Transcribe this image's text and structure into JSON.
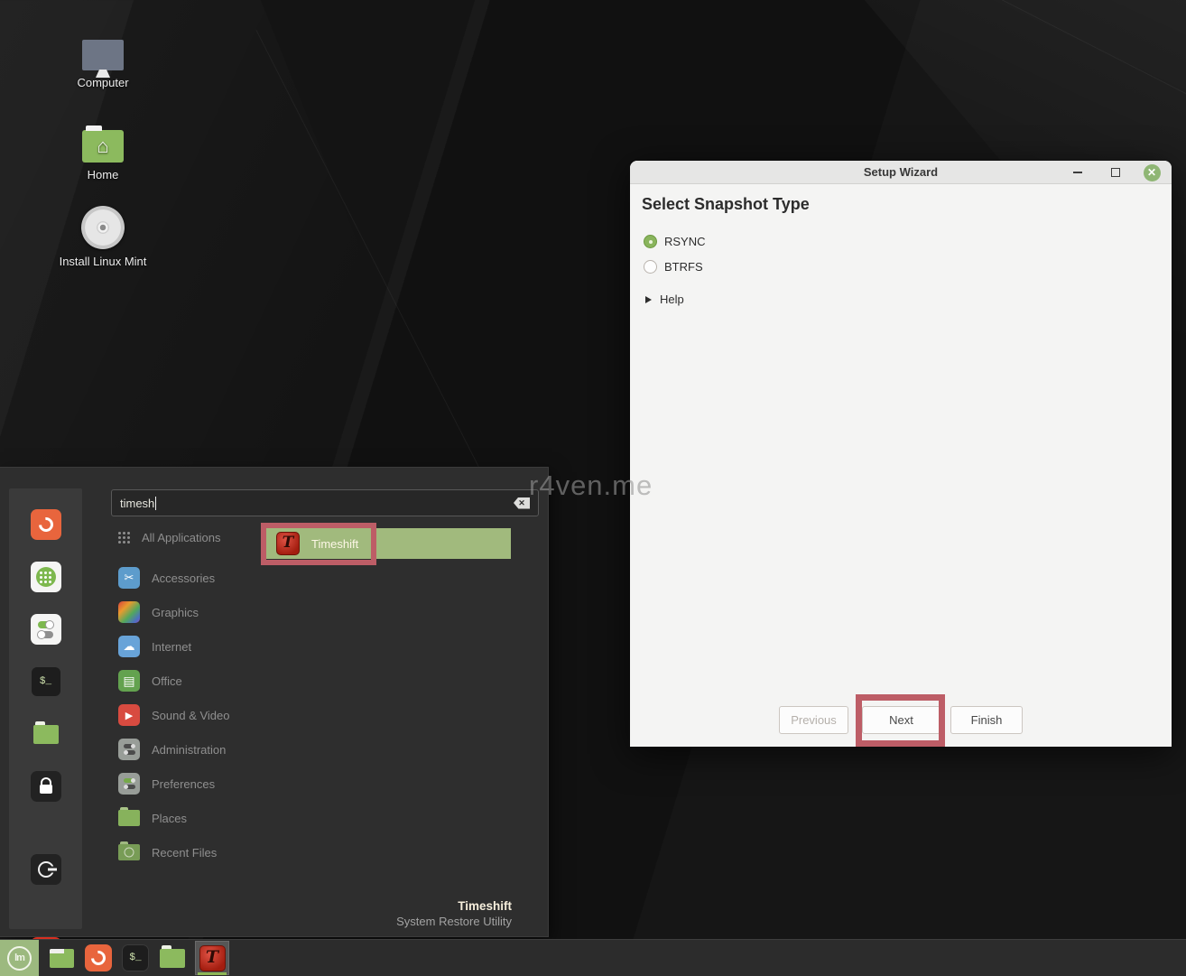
{
  "colors": {
    "selection_green": "#a1ba7d",
    "annotation_red": "#bd5d66",
    "timeshift_red": "#b3220f",
    "close_button_green": "#8fb674",
    "mint_button_green": "#9cb97f",
    "window_body": "#f4f4f3",
    "menu_background": "#2e2e2e"
  },
  "desktop": {
    "watermark": "r4ven.me",
    "icons": [
      {
        "name": "computer",
        "label": "Computer"
      },
      {
        "name": "home",
        "label": "Home"
      },
      {
        "name": "install-linux-mint",
        "label": "Install Linux Mint"
      }
    ]
  },
  "wizard": {
    "title": "Setup Wizard",
    "heading": "Select Snapshot Type",
    "options": [
      {
        "label": "RSYNC",
        "selected": true
      },
      {
        "label": "BTRFS",
        "selected": false
      }
    ],
    "help_label": "Help",
    "buttons": {
      "previous": "Previous",
      "next": "Next",
      "finish": "Finish"
    },
    "window_controls": [
      "minimize-icon",
      "maximize-icon",
      "close-icon"
    ]
  },
  "menu": {
    "search": {
      "value": "timesh",
      "clear_icon": "clear-icon"
    },
    "all_applications_label": "All Applications",
    "result": {
      "label": "Timeshift",
      "icon": "timeshift-icon"
    },
    "categories": [
      "Accessories",
      "Graphics",
      "Internet",
      "Office",
      "Sound & Video",
      "Administration",
      "Preferences",
      "Places",
      "Recent Files"
    ],
    "category_icons": [
      "accessories-icon",
      "graphics-icon",
      "internet-icon",
      "office-icon",
      "sound-video-icon",
      "administration-icon",
      "preferences-icon",
      "places-icon",
      "recent-files-icon"
    ],
    "sidebar_icons": [
      "firefox-icon",
      "software-manager-icon",
      "system-settings-icon",
      "terminal-icon",
      "files-icon",
      "lock-screen-icon",
      "logout-icon",
      "shutdown-icon"
    ],
    "footer": {
      "name": "Timeshift",
      "description": "System Restore Utility"
    }
  },
  "taskbar": {
    "icons": [
      "mint-menu-icon",
      "show-desktop-icon",
      "firefox-icon",
      "terminal-icon",
      "files-icon",
      "timeshift-icon"
    ]
  }
}
